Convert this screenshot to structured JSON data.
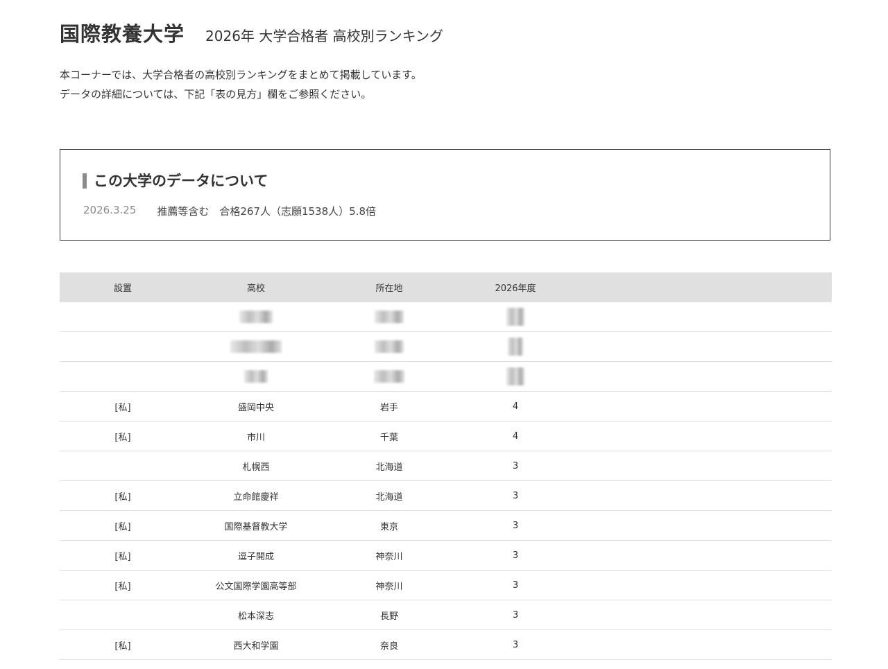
{
  "header": {
    "university_name": "国際教養大学",
    "subtitle": "2026年 大学合格者 高校別ランキング"
  },
  "intro": {
    "line1": "本コーナーでは、大学合格者の高校別ランキングをまとめて掲載しています。",
    "line2": "データの詳細については、下記「表の見方」欄をご参照ください。"
  },
  "info_box": {
    "title": "この大学のデータについて",
    "date": "2026.3.25",
    "detail": "推薦等含む　合格267人（志願1538人）5.8倍"
  },
  "table": {
    "headers": [
      "設置",
      "高校",
      "所在地",
      "2026年度"
    ],
    "blurred_rows": 3,
    "rows": [
      {
        "type": "[私]",
        "school": "盛岡中央",
        "location": "岩手",
        "count": "4"
      },
      {
        "type": "[私]",
        "school": "市川",
        "location": "千葉",
        "count": "4"
      },
      {
        "type": "",
        "school": "札幌西",
        "location": "北海道",
        "count": "3"
      },
      {
        "type": "[私]",
        "school": "立命館慶祥",
        "location": "北海道",
        "count": "3"
      },
      {
        "type": "[私]",
        "school": "国際基督教大学",
        "location": "東京",
        "count": "3"
      },
      {
        "type": "[私]",
        "school": "逗子開成",
        "location": "神奈川",
        "count": "3"
      },
      {
        "type": "[私]",
        "school": "公文国際学園高等部",
        "location": "神奈川",
        "count": "3"
      },
      {
        "type": "",
        "school": "松本深志",
        "location": "長野",
        "count": "3"
      },
      {
        "type": "[私]",
        "school": "西大和学園",
        "location": "奈良",
        "count": "3"
      }
    ]
  }
}
